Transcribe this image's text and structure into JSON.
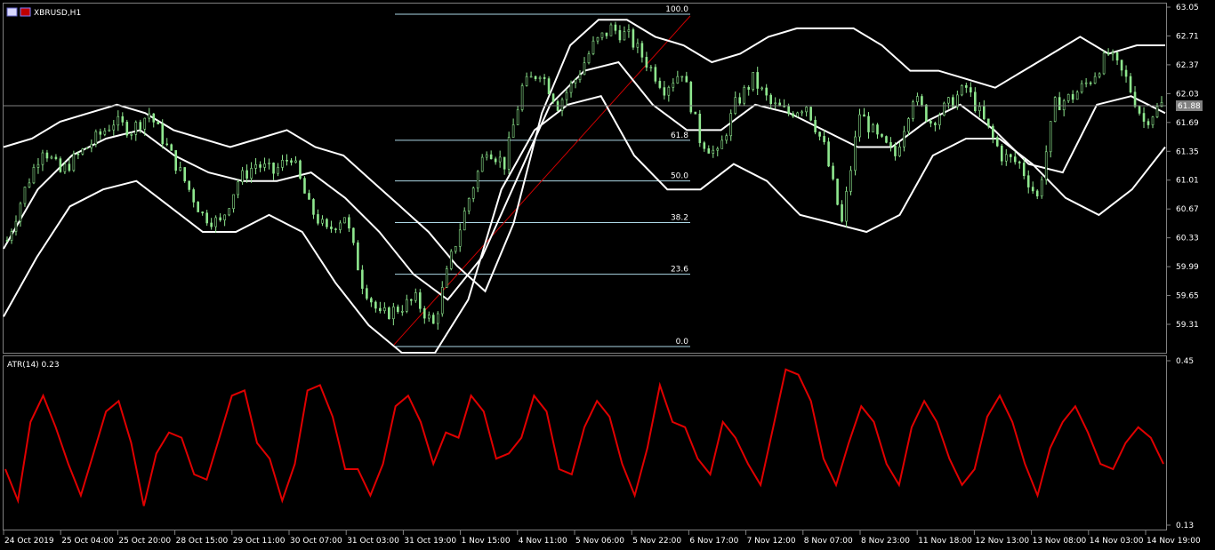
{
  "window": {
    "symbol_title": "XBRUSD,H1"
  },
  "indicator": {
    "label": "ATR(14) 0.23"
  },
  "chart_data": [
    {
      "type": "candlestick",
      "title": "XBRUSD,H1",
      "y_ticks": [
        "63.05",
        "62.71",
        "62.37",
        "62.03",
        "61.69",
        "61.35",
        "61.01",
        "60.67",
        "60.33",
        "59.99",
        "59.65",
        "59.31"
      ],
      "ylim": [
        59.05,
        63.15
      ],
      "current_price": "61.88",
      "x_ticks": [
        "24 Oct 2019",
        "25 Oct 04:00",
        "25 Oct 20:00",
        "28 Oct 15:00",
        "29 Oct 11:00",
        "30 Oct 07:00",
        "31 Oct 03:00",
        "31 Oct 19:00",
        "1 Nov 15:00",
        "4 Nov 11:00",
        "5 Nov 06:00",
        "5 Nov 22:00",
        "6 Nov 17:00",
        "7 Nov 12:00",
        "8 Nov 07:00",
        "8 Nov 23:00",
        "11 Nov 18:00",
        "12 Nov 13:00",
        "13 Nov 08:00",
        "14 Nov 03:00",
        "14 Nov 19:00"
      ],
      "closes": [
        60.3,
        60.9,
        61.4,
        61.1,
        61.3,
        61.5,
        61.7,
        61.6,
        61.8,
        61.4,
        61.0,
        60.6,
        60.5,
        61.0,
        61.2,
        61.1,
        61.3,
        60.7,
        60.4,
        60.6,
        59.8,
        59.4,
        59.5,
        59.6,
        59.3,
        60.1,
        60.8,
        61.4,
        61.2,
        62.1,
        62.3,
        61.9,
        62.2,
        62.6,
        62.8,
        62.7,
        62.4,
        62.1,
        62.3,
        61.5,
        61.3,
        61.9,
        62.2,
        61.9,
        61.8,
        61.9,
        61.4,
        60.5,
        61.8,
        61.5,
        61.3,
        62.0,
        61.7,
        61.9,
        62.1,
        61.7,
        61.3,
        61.2,
        60.8,
        61.9,
        62.0,
        62.2,
        62.5,
        62.2,
        61.7,
        61.9
      ],
      "bollinger": {
        "upper": [
          61.4,
          61.5,
          61.7,
          61.8,
          61.9,
          61.8,
          61.6,
          61.5,
          61.4,
          61.5,
          61.6,
          61.4,
          61.3,
          61.0,
          60.7,
          60.4,
          60.0,
          59.7,
          60.5,
          61.8,
          62.6,
          62.9,
          62.9,
          62.7,
          62.6,
          62.4,
          62.5,
          62.7,
          62.8,
          62.8,
          62.8,
          62.6,
          62.3,
          62.3,
          62.2,
          62.1,
          62.3,
          62.5,
          62.7,
          62.5,
          62.6,
          62.6
        ],
        "middle": [
          60.2,
          60.9,
          61.3,
          61.5,
          61.6,
          61.3,
          61.1,
          61.0,
          61.0,
          61.1,
          60.8,
          60.4,
          59.9,
          59.6,
          60.1,
          61.0,
          61.9,
          62.3,
          62.4,
          61.9,
          61.6,
          61.6,
          61.9,
          61.8,
          61.6,
          61.4,
          61.4,
          61.7,
          61.9,
          61.6,
          61.2,
          61.1,
          61.9,
          62.0,
          61.8
        ],
        "lower": [
          59.4,
          60.1,
          60.7,
          60.9,
          61.0,
          60.7,
          60.4,
          60.4,
          60.6,
          60.4,
          59.8,
          59.3,
          58.9,
          58.9,
          59.6,
          60.9,
          61.6,
          61.9,
          62.0,
          61.3,
          60.9,
          60.9,
          61.2,
          61.0,
          60.6,
          60.5,
          60.4,
          60.6,
          61.3,
          61.5,
          61.5,
          61.2,
          60.8,
          60.6,
          60.9,
          61.4
        ]
      },
      "fibonacci": {
        "levels": [
          {
            "label": "100.0",
            "price": 63.05
          },
          {
            "label": "61.8",
            "price": 61.48
          },
          {
            "label": "50.0",
            "price": 61.0
          },
          {
            "label": "38.2",
            "price": 60.51
          },
          {
            "label": "23.6",
            "price": 59.9
          },
          {
            "label": "0.0",
            "price": 58.99
          }
        ]
      },
      "colors": {
        "candle": "#8fe88f",
        "bands": "#ffffff",
        "fib": "#add8e6",
        "trendline": "#cc0000",
        "grid_line": "#808080"
      }
    },
    {
      "type": "line",
      "title": "ATR(14) 0.23",
      "y_ticks": [
        "0.45",
        "0.13"
      ],
      "ylim": [
        0.13,
        0.45
      ],
      "series": [
        {
          "values": [
            0.24,
            0.18,
            0.33,
            0.38,
            0.32,
            0.25,
            0.19,
            0.27,
            0.35,
            0.37,
            0.29,
            0.17,
            0.27,
            0.31,
            0.3,
            0.23,
            0.22,
            0.3,
            0.38,
            0.39,
            0.29,
            0.26,
            0.18,
            0.25,
            0.39,
            0.4,
            0.34,
            0.24,
            0.24,
            0.19,
            0.25,
            0.36,
            0.38,
            0.33,
            0.25,
            0.31,
            0.3,
            0.38,
            0.35,
            0.26,
            0.27,
            0.3,
            0.38,
            0.35,
            0.24,
            0.23,
            0.32,
            0.37,
            0.34,
            0.25,
            0.19,
            0.28,
            0.4,
            0.33,
            0.32,
            0.26,
            0.23,
            0.33,
            0.3,
            0.25,
            0.21,
            0.32,
            0.43,
            0.42,
            0.37,
            0.26,
            0.21,
            0.29,
            0.36,
            0.33,
            0.25,
            0.21,
            0.32,
            0.37,
            0.33,
            0.26,
            0.21,
            0.24,
            0.34,
            0.38,
            0.33,
            0.25,
            0.19,
            0.28,
            0.33,
            0.36,
            0.31,
            0.25,
            0.24,
            0.29,
            0.32,
            0.3,
            0.25
          ]
        }
      ],
      "colors": {
        "line": "#e00000"
      }
    }
  ]
}
